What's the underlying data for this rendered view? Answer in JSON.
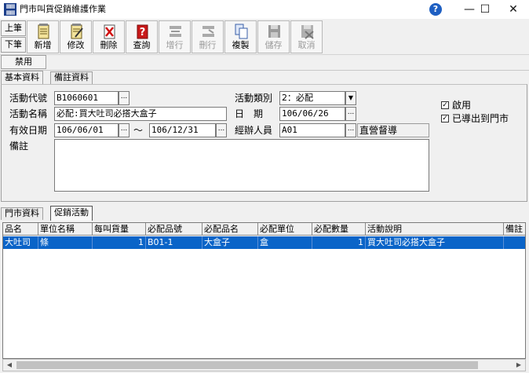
{
  "window": {
    "title": "門市叫貨促銷維護作業",
    "minimize_glyph": "—",
    "maximize_glyph": "☐",
    "close_glyph": "✕",
    "help_glyph": "?"
  },
  "toolbar": {
    "prev_label": "上筆",
    "next_label": "下筆",
    "buttons": [
      {
        "id": "add",
        "label": "新增",
        "icon": "notepad-add-icon",
        "enabled": true
      },
      {
        "id": "edit",
        "label": "修改",
        "icon": "notepad-edit-icon",
        "enabled": true
      },
      {
        "id": "delete",
        "label": "刪除",
        "icon": "delete-x-icon",
        "enabled": true
      },
      {
        "id": "query",
        "label": "查詢",
        "icon": "question-icon",
        "enabled": true
      },
      {
        "id": "add-row",
        "label": "增行",
        "icon": "add-row-icon",
        "enabled": false
      },
      {
        "id": "del-row",
        "label": "刪行",
        "icon": "delete-row-icon",
        "enabled": false
      },
      {
        "id": "copy",
        "label": "複製",
        "icon": "copy-icon",
        "enabled": true
      },
      {
        "id": "save",
        "label": "儲存",
        "icon": "floppy-icon",
        "enabled": false
      },
      {
        "id": "cancel",
        "label": "取消",
        "icon": "cancel-icon",
        "enabled": false
      }
    ],
    "disable_label": "禁用"
  },
  "tabs_top": [
    {
      "label": "基本資料",
      "active": true
    },
    {
      "label": "備註資料",
      "active": false
    }
  ],
  "form": {
    "activity_code_label": "活動代號",
    "activity_code_value": "B1060601",
    "activity_name_label": "活動名稱",
    "activity_name_value": "必配:買大吐司必搭大盒子",
    "valid_date_label": "有效日期",
    "valid_from_value": "106/06/01",
    "tilde": "～",
    "valid_to_value": "106/12/31",
    "remark_label": "備註",
    "remark_value": "",
    "category_label": "活動類別",
    "category_value": "2：必配",
    "date_label": "日　期",
    "date_value": "106/06/26",
    "handler_label": "經辦人員",
    "handler_value": "A01",
    "handler_name": "直營督導",
    "enable_label": "啟用",
    "enable_checked": true,
    "exported_label": "已導出到門市",
    "exported_checked": true,
    "dots_glyph": "...",
    "combo_glyph": "▼",
    "check_glyph": "✓"
  },
  "tabs_bottom": [
    {
      "label": "門市資料",
      "active": false
    },
    {
      "label": "促銷活動",
      "active": true
    }
  ],
  "grid": {
    "columns": [
      "品名",
      "單位名稱",
      "每叫貨量",
      "必配品號",
      "必配品名",
      "必配單位",
      "必配數量",
      "活動說明",
      "備註"
    ],
    "rows": [
      [
        "大吐司",
        "條",
        "1",
        "B01-1",
        "大盒子",
        "盒",
        "1",
        "買大吐司必搭大盒子",
        ""
      ]
    ]
  },
  "scrollbar": {
    "left_glyph": "◀",
    "right_glyph": "▶"
  }
}
